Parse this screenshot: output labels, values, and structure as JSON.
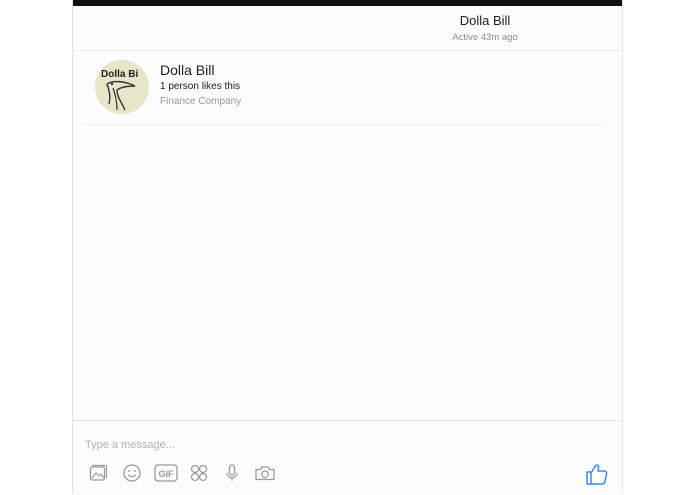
{
  "header": {
    "name": "Dolla Bill",
    "status": "Active 43m ago"
  },
  "page_card": {
    "name": "Dolla Bill",
    "likes": "1 person likes this",
    "category": "Finance Company",
    "avatar_text": "Dolla Bi"
  },
  "composer": {
    "placeholder": "Type a message...",
    "tools": [
      "stickers-icon",
      "emoji-icon",
      "gif-icon",
      "games-icon",
      "microphone-icon",
      "camera-icon"
    ],
    "gif_label": "GIF"
  },
  "colors": {
    "accent": "#3b8ce0",
    "icon_gray": "#9a9a9a",
    "avatar_bg": "#e8e6c8"
  }
}
